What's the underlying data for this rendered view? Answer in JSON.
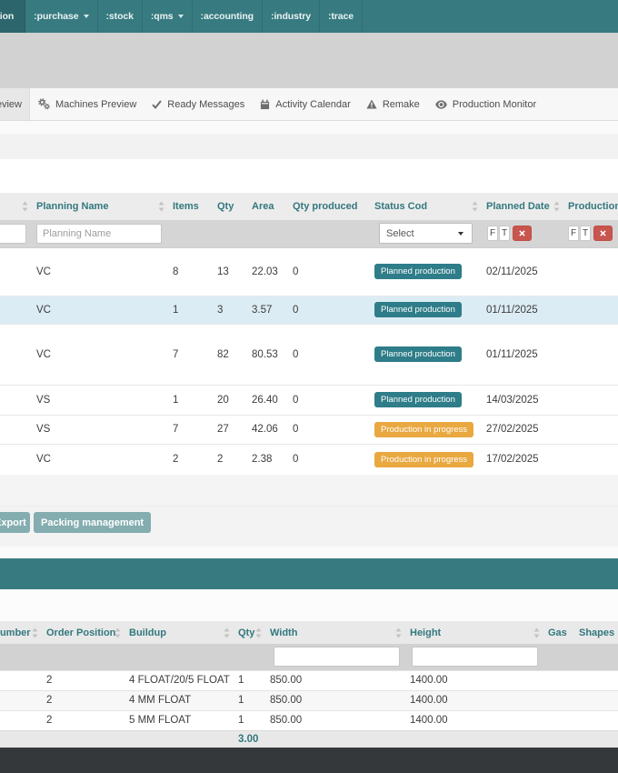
{
  "colors": {
    "navbar_teal": "#377b81",
    "nav_active_teal": "#2c666c",
    "badge_planned_teal": "#2e7d89",
    "badge_progress_orange": "#e9a840",
    "action_button_teal": "#84adb0",
    "clear_button_red": "#c9554f",
    "header_text_teal": "#31787e",
    "selected_row_blue": "#dcecf4",
    "footer_dark": "#35383b"
  },
  "navbar": {
    "items": [
      {
        "label": ":production",
        "active": true,
        "caret": false
      },
      {
        "label": ":purchase",
        "active": false,
        "caret": true
      },
      {
        "label": ":stock",
        "active": false,
        "caret": false
      },
      {
        "label": ":qms",
        "active": false,
        "caret": true
      },
      {
        "label": ":accounting",
        "active": false,
        "caret": false
      },
      {
        "label": ":industry",
        "active": false,
        "caret": false
      },
      {
        "label": ":trace",
        "active": false,
        "caret": false
      }
    ]
  },
  "tabs": {
    "items": [
      {
        "label": "Planning Preview",
        "icon": "",
        "active": true
      },
      {
        "label": "Machines Preview",
        "icon": "cogs",
        "active": false
      },
      {
        "label": "Ready Messages",
        "icon": "check",
        "active": false
      },
      {
        "label": "Activity Calendar",
        "icon": "calendar",
        "active": false
      },
      {
        "label": "Remake",
        "icon": "warning",
        "active": false
      },
      {
        "label": "Production Monitor",
        "icon": "eye",
        "active": false
      }
    ]
  },
  "planning_table": {
    "columns": [
      {
        "label": "",
        "sortable": true
      },
      {
        "label": "Planning Name",
        "sortable": true
      },
      {
        "label": "Items",
        "sortable": false
      },
      {
        "label": "Qty",
        "sortable": false
      },
      {
        "label": "Area",
        "sortable": false
      },
      {
        "label": "Qty produced",
        "sortable": false
      },
      {
        "label": "Status Cod",
        "sortable": true
      },
      {
        "label": "Planned Date",
        "sortable": true
      },
      {
        "label": "Production",
        "sortable": false
      }
    ],
    "filters": {
      "planning_name_placeholder": "Planning Name",
      "status_select_label": "Select",
      "from_label": "F",
      "to_label": "T"
    },
    "rows": [
      {
        "planning_name": "VC",
        "items": "8",
        "qty": "13",
        "area": "22.03",
        "qty_produced": "0",
        "status_label": "Planned production",
        "status_type": "planned",
        "planned_date": "02/11/2025",
        "selected": false
      },
      {
        "planning_name": "VC",
        "items": "1",
        "qty": "3",
        "area": "3.57",
        "qty_produced": "0",
        "status_label": "Planned production",
        "status_type": "planned",
        "planned_date": "01/11/2025",
        "selected": true
      },
      {
        "planning_name": "VC",
        "items": "7",
        "qty": "82",
        "area": "80.53",
        "qty_produced": "0",
        "status_label": "Planned production",
        "status_type": "planned",
        "planned_date": "01/11/2025",
        "selected": false
      },
      {
        "planning_name": "VS",
        "items": "1",
        "qty": "20",
        "area": "26.40",
        "qty_produced": "0",
        "status_label": "Planned production",
        "status_type": "planned",
        "planned_date": "14/03/2025",
        "selected": false
      },
      {
        "planning_name": "VS",
        "items": "7",
        "qty": "27",
        "area": "42.06",
        "qty_produced": "0",
        "status_label": "Production in progress",
        "status_type": "progress",
        "planned_date": "27/02/2025",
        "selected": false
      },
      {
        "planning_name": "VC",
        "items": "2",
        "qty": "2",
        "area": "2.38",
        "qty_produced": "0",
        "status_label": "Production in progress",
        "status_type": "progress",
        "planned_date": "17/02/2025",
        "selected": false
      }
    ]
  },
  "actions": {
    "export_label": "Export",
    "packing_label": "Packing management"
  },
  "items_table": {
    "columns": [
      {
        "label": "Order Number",
        "sortable": true
      },
      {
        "label": "Order Position",
        "sortable": true
      },
      {
        "label": "Buildup",
        "sortable": true
      },
      {
        "label": "Qty",
        "sortable": true
      },
      {
        "label": "Width",
        "sortable": true
      },
      {
        "label": "Height",
        "sortable": true
      },
      {
        "label": "Gas",
        "sortable": false
      },
      {
        "label": "Shapes",
        "sortable": false
      }
    ],
    "rows": [
      {
        "order_position": "2",
        "buildup": "4 FLOAT/20/5 FLOAT",
        "qty": "1",
        "width": "850.00",
        "height": "1400.00"
      },
      {
        "order_position": "2",
        "buildup": "4 MM FLOAT",
        "qty": "1",
        "width": "850.00",
        "height": "1400.00"
      },
      {
        "order_position": "2",
        "buildup": "5 MM FLOAT",
        "qty": "1",
        "width": "850.00",
        "height": "1400.00"
      }
    ],
    "total_qty": "3.00"
  }
}
